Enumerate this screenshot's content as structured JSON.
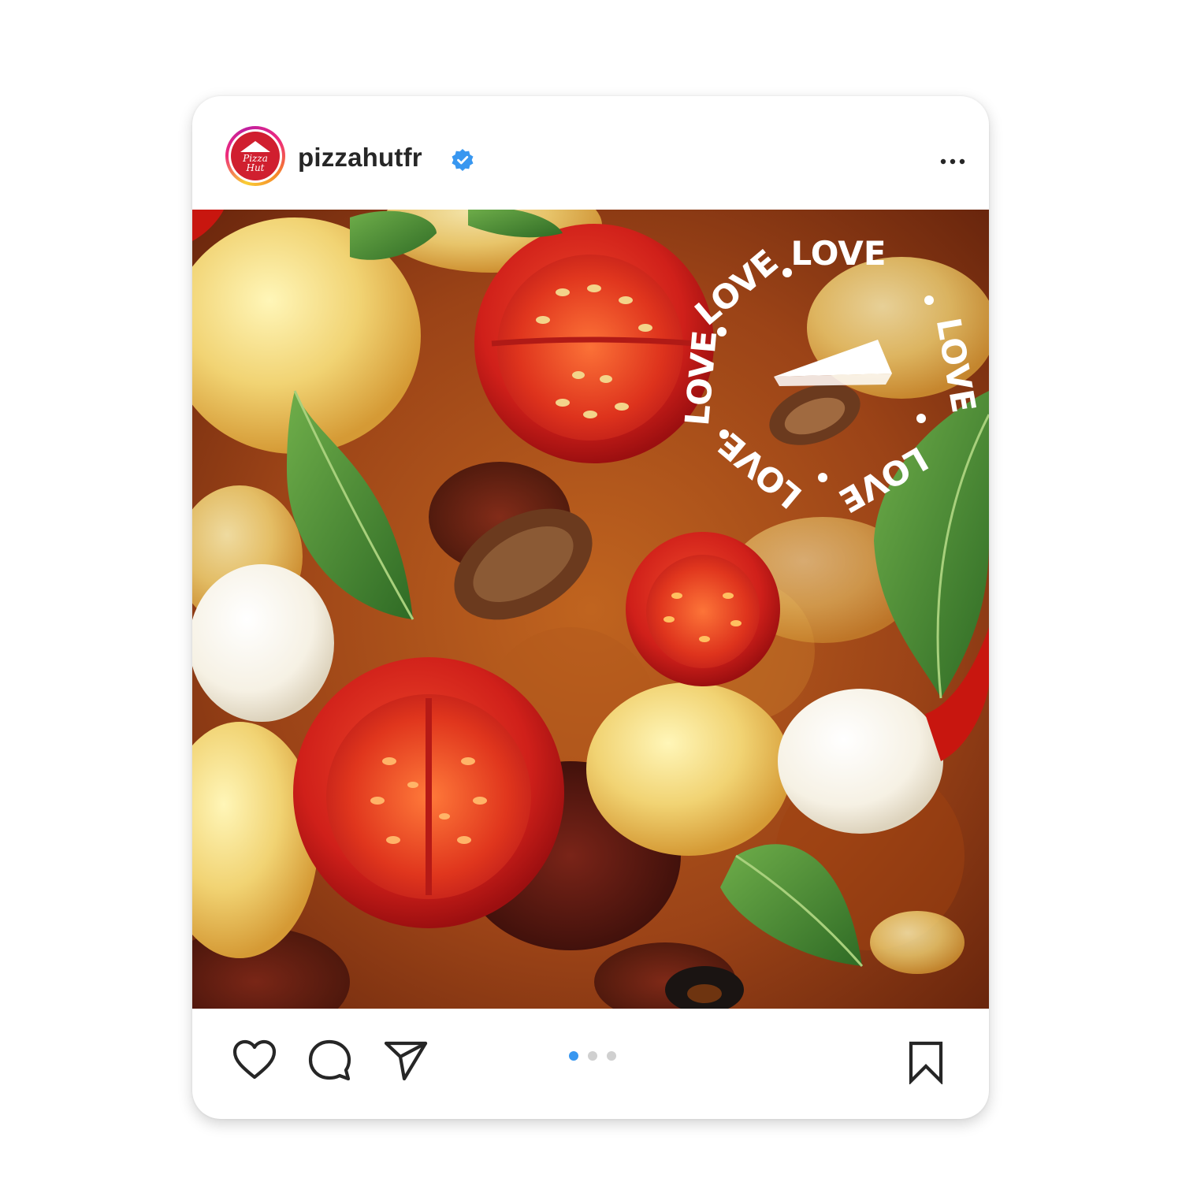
{
  "post": {
    "username": "pizzahutfr",
    "verified": true,
    "avatar_logo_text_line1": "Pizza",
    "avatar_logo_text_line2": "Hut",
    "overlay_badge_word": "LOVE",
    "carousel": {
      "total": 3,
      "active_index": 0
    },
    "icons": {
      "verified": "verified-badge-icon",
      "more": "more-options-icon",
      "like": "heart-icon",
      "comment": "comment-icon",
      "share": "paper-plane-icon",
      "save": "bookmark-icon"
    },
    "colors": {
      "accent_blue": "#3897f0",
      "dot_inactive": "#d0d0d0",
      "brand_red": "#d01f2f",
      "text": "#262626"
    }
  }
}
